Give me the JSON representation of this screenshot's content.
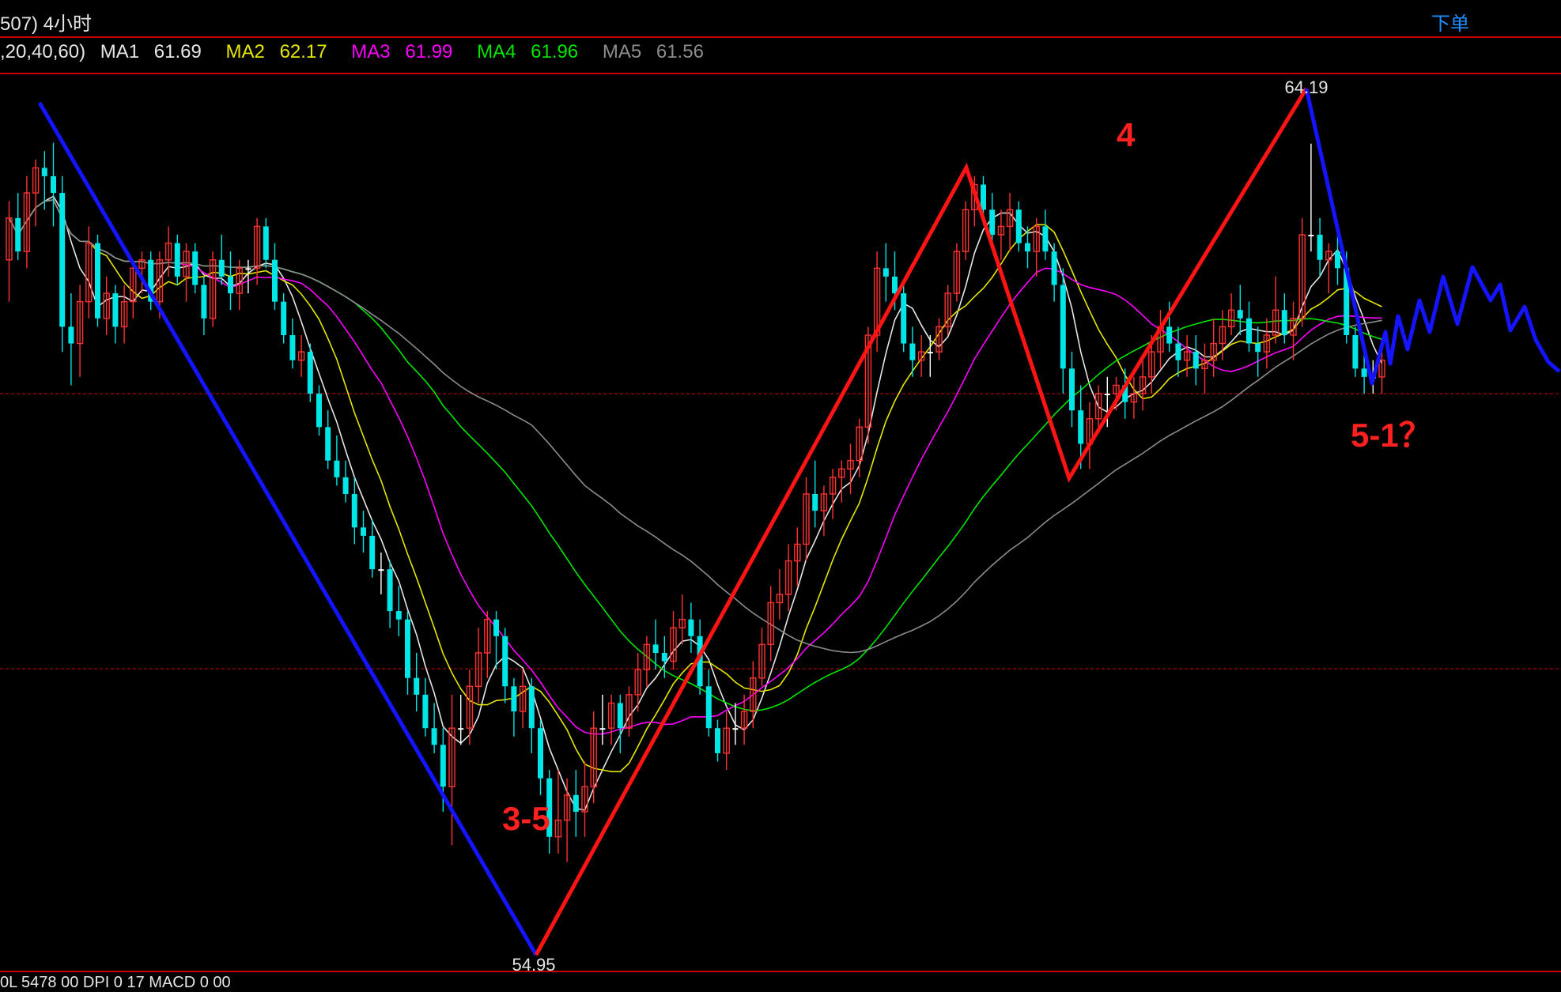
{
  "header": {
    "title": "507) 4小时",
    "order_button": "下单"
  },
  "ma_bar": {
    "params": ",20,40,60)",
    "items": [
      {
        "label": "MA1",
        "value": "61.69",
        "color": "#e6e6e6"
      },
      {
        "label": "MA2",
        "value": "62.17",
        "color": "#e6e600"
      },
      {
        "label": "MA3",
        "value": "61.99",
        "color": "#ff00ff"
      },
      {
        "label": "MA4",
        "value": "61.96",
        "color": "#00e600"
      },
      {
        "label": "MA5",
        "value": "61.56",
        "color": "#8c8c8c"
      }
    ]
  },
  "bottom_text": "0L 5478 00  DPI 0 17 MACD 0 00",
  "chart_data": {
    "type": "candlestick",
    "price_axis_range": [
      54.3,
      65.0
    ],
    "high_label": "64.19",
    "low_label": "54.95",
    "colors": {
      "up": "#ff3232",
      "down": "#00e6e6",
      "doji": "#ffffff"
    },
    "candles": [
      [
        62.8,
        63.5,
        62.3,
        63.3
      ],
      [
        63.3,
        63.6,
        62.8,
        62.9
      ],
      [
        62.9,
        63.8,
        62.7,
        63.6
      ],
      [
        63.6,
        64.0,
        63.2,
        63.9
      ],
      [
        63.9,
        64.1,
        63.4,
        63.8
      ],
      [
        63.8,
        64.2,
        63.2,
        63.6
      ],
      [
        63.6,
        63.8,
        61.7,
        62.0
      ],
      [
        62.0,
        62.4,
        61.3,
        61.8
      ],
      [
        61.8,
        62.5,
        61.4,
        62.3
      ],
      [
        62.3,
        63.2,
        62.1,
        63.0
      ],
      [
        63.0,
        63.1,
        62.0,
        62.1
      ],
      [
        62.1,
        62.6,
        61.9,
        62.4
      ],
      [
        62.4,
        62.5,
        61.8,
        62.0
      ],
      [
        62.0,
        62.5,
        61.8,
        62.3
      ],
      [
        62.3,
        62.8,
        62.1,
        62.7
      ],
      [
        62.7,
        62.9,
        62.4,
        62.8
      ],
      [
        62.8,
        62.9,
        62.2,
        62.3
      ],
      [
        62.3,
        62.9,
        62.1,
        62.8
      ],
      [
        62.8,
        63.2,
        62.6,
        63.0
      ],
      [
        63.0,
        63.1,
        62.5,
        62.6
      ],
      [
        62.6,
        63.0,
        62.3,
        62.9
      ],
      [
        62.9,
        63.0,
        62.4,
        62.5
      ],
      [
        62.5,
        62.6,
        61.9,
        62.1
      ],
      [
        62.1,
        62.9,
        62.0,
        62.8
      ],
      [
        62.8,
        63.1,
        62.5,
        62.6
      ],
      [
        62.6,
        62.9,
        62.2,
        62.4
      ],
      [
        62.4,
        62.8,
        62.2,
        62.7
      ],
      [
        62.7,
        62.8,
        62.4,
        62.7
      ],
      [
        62.7,
        63.3,
        62.5,
        63.2
      ],
      [
        63.2,
        63.3,
        62.7,
        62.8
      ],
      [
        62.8,
        63.0,
        62.2,
        62.3
      ],
      [
        62.3,
        62.4,
        61.8,
        61.9
      ],
      [
        61.9,
        62.1,
        61.5,
        61.6
      ],
      [
        61.6,
        61.9,
        61.4,
        61.7
      ],
      [
        61.7,
        61.8,
        61.1,
        61.2
      ],
      [
        61.2,
        61.3,
        60.7,
        60.8
      ],
      [
        60.8,
        61.0,
        60.3,
        60.4
      ],
      [
        60.4,
        60.7,
        60.1,
        60.2
      ],
      [
        60.2,
        60.4,
        59.9,
        60.0
      ],
      [
        60.0,
        60.2,
        59.4,
        59.6
      ],
      [
        59.6,
        59.8,
        59.3,
        59.5
      ],
      [
        59.5,
        59.7,
        59.0,
        59.1
      ],
      [
        59.1,
        59.3,
        58.8,
        59.1
      ],
      [
        59.1,
        59.2,
        58.4,
        58.6
      ],
      [
        58.6,
        58.9,
        58.3,
        58.5
      ],
      [
        58.5,
        58.6,
        57.6,
        57.8
      ],
      [
        57.8,
        58.1,
        57.4,
        57.6
      ],
      [
        57.6,
        57.8,
        57.1,
        57.2
      ],
      [
        57.2,
        57.5,
        56.9,
        57.0
      ],
      [
        57.0,
        57.2,
        56.2,
        56.5
      ],
      [
        56.5,
        57.6,
        55.8,
        57.2
      ],
      [
        57.2,
        57.6,
        57.0,
        57.2
      ],
      [
        57.2,
        57.9,
        57.0,
        57.7
      ],
      [
        57.7,
        58.4,
        57.5,
        58.1
      ],
      [
        58.1,
        58.6,
        57.8,
        58.5
      ],
      [
        58.5,
        58.6,
        57.9,
        58.3
      ],
      [
        58.3,
        58.4,
        57.5,
        57.7
      ],
      [
        57.7,
        57.8,
        57.1,
        57.4
      ],
      [
        57.4,
        57.9,
        57.2,
        57.7
      ],
      [
        57.7,
        57.8,
        56.9,
        57.2
      ],
      [
        57.2,
        57.3,
        56.4,
        56.6
      ],
      [
        56.6,
        56.7,
        55.7,
        55.9
      ],
      [
        55.9,
        56.7,
        55.7,
        56.1
      ],
      [
        56.1,
        56.6,
        55.6,
        56.4
      ],
      [
        56.4,
        56.7,
        55.9,
        56.2
      ],
      [
        56.2,
        56.8,
        55.9,
        56.5
      ],
      [
        56.5,
        57.4,
        56.3,
        57.2
      ],
      [
        57.2,
        57.6,
        57.0,
        57.2
      ],
      [
        57.2,
        57.6,
        57.0,
        57.5
      ],
      [
        57.5,
        57.6,
        56.9,
        57.2
      ],
      [
        57.2,
        57.7,
        57.1,
        57.6
      ],
      [
        57.6,
        58.1,
        57.4,
        57.9
      ],
      [
        57.9,
        58.3,
        57.7,
        58.2
      ],
      [
        58.2,
        58.5,
        57.9,
        58.1
      ],
      [
        58.1,
        58.3,
        57.8,
        58.0
      ],
      [
        58.0,
        58.6,
        57.9,
        58.4
      ],
      [
        58.4,
        58.8,
        58.2,
        58.5
      ],
      [
        58.5,
        58.7,
        58.1,
        58.3
      ],
      [
        58.3,
        58.5,
        57.6,
        57.7
      ],
      [
        57.7,
        57.9,
        57.1,
        57.2
      ],
      [
        57.2,
        57.3,
        56.8,
        56.9
      ],
      [
        56.9,
        57.4,
        56.7,
        57.2
      ],
      [
        57.2,
        57.5,
        57.0,
        57.2
      ],
      [
        57.2,
        57.6,
        57.0,
        57.4
      ],
      [
        57.4,
        58.0,
        57.2,
        57.8
      ],
      [
        57.8,
        58.4,
        57.7,
        58.2
      ],
      [
        58.2,
        58.9,
        58.0,
        58.7
      ],
      [
        58.7,
        59.1,
        58.5,
        58.8
      ],
      [
        58.8,
        59.4,
        58.6,
        59.2
      ],
      [
        59.2,
        59.6,
        58.9,
        59.4
      ],
      [
        59.4,
        60.2,
        59.2,
        60.0
      ],
      [
        60.0,
        60.4,
        59.6,
        59.8
      ],
      [
        59.8,
        60.1,
        59.5,
        60.0
      ],
      [
        60.0,
        60.3,
        59.7,
        60.2
      ],
      [
        60.2,
        60.4,
        59.9,
        60.3
      ],
      [
        60.3,
        60.6,
        60.0,
        60.4
      ],
      [
        60.4,
        60.9,
        60.2,
        60.8
      ],
      [
        60.8,
        62.0,
        60.6,
        61.9
      ],
      [
        61.9,
        62.9,
        61.7,
        62.7
      ],
      [
        62.7,
        63.0,
        62.3,
        62.6
      ],
      [
        62.6,
        62.9,
        62.2,
        62.4
      ],
      [
        62.4,
        62.5,
        61.7,
        61.8
      ],
      [
        61.8,
        62.0,
        61.4,
        61.6
      ],
      [
        61.6,
        61.9,
        61.4,
        61.7
      ],
      [
        61.7,
        61.9,
        61.4,
        61.7
      ],
      [
        61.7,
        62.1,
        61.6,
        62.0
      ],
      [
        62.0,
        62.5,
        61.9,
        62.4
      ],
      [
        62.4,
        63.0,
        62.3,
        62.9
      ],
      [
        62.9,
        63.5,
        62.8,
        63.4
      ],
      [
        63.4,
        63.8,
        63.2,
        63.7
      ],
      [
        63.7,
        63.8,
        63.3,
        63.4
      ],
      [
        63.4,
        63.6,
        63.0,
        63.1
      ],
      [
        63.1,
        63.4,
        62.8,
        63.2
      ],
      [
        63.2,
        63.6,
        62.9,
        63.4
      ],
      [
        63.4,
        63.5,
        62.9,
        63.0
      ],
      [
        63.0,
        63.2,
        62.7,
        62.9
      ],
      [
        62.9,
        63.3,
        62.6,
        63.2
      ],
      [
        63.2,
        63.4,
        62.8,
        62.9
      ],
      [
        62.9,
        63.0,
        62.3,
        62.5
      ],
      [
        62.5,
        62.7,
        61.2,
        61.5
      ],
      [
        61.5,
        61.7,
        60.8,
        61.0
      ],
      [
        61.0,
        61.3,
        60.3,
        60.6
      ],
      [
        60.6,
        61.1,
        60.3,
        60.9
      ],
      [
        60.9,
        61.3,
        60.8,
        61.2
      ],
      [
        61.2,
        61.4,
        60.8,
        61.2
      ],
      [
        61.2,
        61.4,
        61.0,
        61.3
      ],
      [
        61.3,
        61.5,
        60.9,
        61.1
      ],
      [
        61.1,
        61.4,
        60.9,
        61.2
      ],
      [
        61.2,
        61.6,
        61.0,
        61.4
      ],
      [
        61.4,
        61.9,
        61.2,
        61.7
      ],
      [
        61.7,
        62.2,
        61.5,
        62.0
      ],
      [
        62.0,
        62.3,
        61.7,
        61.8
      ],
      [
        61.8,
        62.0,
        61.4,
        61.6
      ],
      [
        61.6,
        61.9,
        61.4,
        61.7
      ],
      [
        61.7,
        61.9,
        61.3,
        61.5
      ],
      [
        61.5,
        61.8,
        61.2,
        61.6
      ],
      [
        61.6,
        62.1,
        61.4,
        61.8
      ],
      [
        61.8,
        62.2,
        61.6,
        62.0
      ],
      [
        62.0,
        62.4,
        61.9,
        62.2
      ],
      [
        62.2,
        62.5,
        61.9,
        62.1
      ],
      [
        62.1,
        62.3,
        61.7,
        61.8
      ],
      [
        61.8,
        62.0,
        61.4,
        61.7
      ],
      [
        61.7,
        62.1,
        61.5,
        61.9
      ],
      [
        61.9,
        62.6,
        61.8,
        62.2
      ],
      [
        62.2,
        62.4,
        61.8,
        61.9
      ],
      [
        61.9,
        62.3,
        61.6,
        62.1
      ],
      [
        62.1,
        63.3,
        62.0,
        63.1
      ],
      [
        63.1,
        64.19,
        62.9,
        63.1
      ],
      [
        63.1,
        63.3,
        62.6,
        62.8
      ],
      [
        62.8,
        63.0,
        62.4,
        62.9
      ],
      [
        62.9,
        63.1,
        62.5,
        62.7
      ],
      [
        62.7,
        62.9,
        61.8,
        61.9
      ],
      [
        61.9,
        62.0,
        61.4,
        61.5
      ],
      [
        61.5,
        61.7,
        61.2,
        61.4
      ],
      [
        61.4,
        61.6,
        61.2,
        61.4
      ],
      [
        61.4,
        61.7,
        61.2,
        61.6
      ]
    ],
    "annotations": [
      {
        "text": "4",
        "color": "#ff2020"
      },
      {
        "text": "3-5",
        "color": "#ff2020"
      },
      {
        "text": "5-1？",
        "color": "#ff2020"
      }
    ]
  }
}
